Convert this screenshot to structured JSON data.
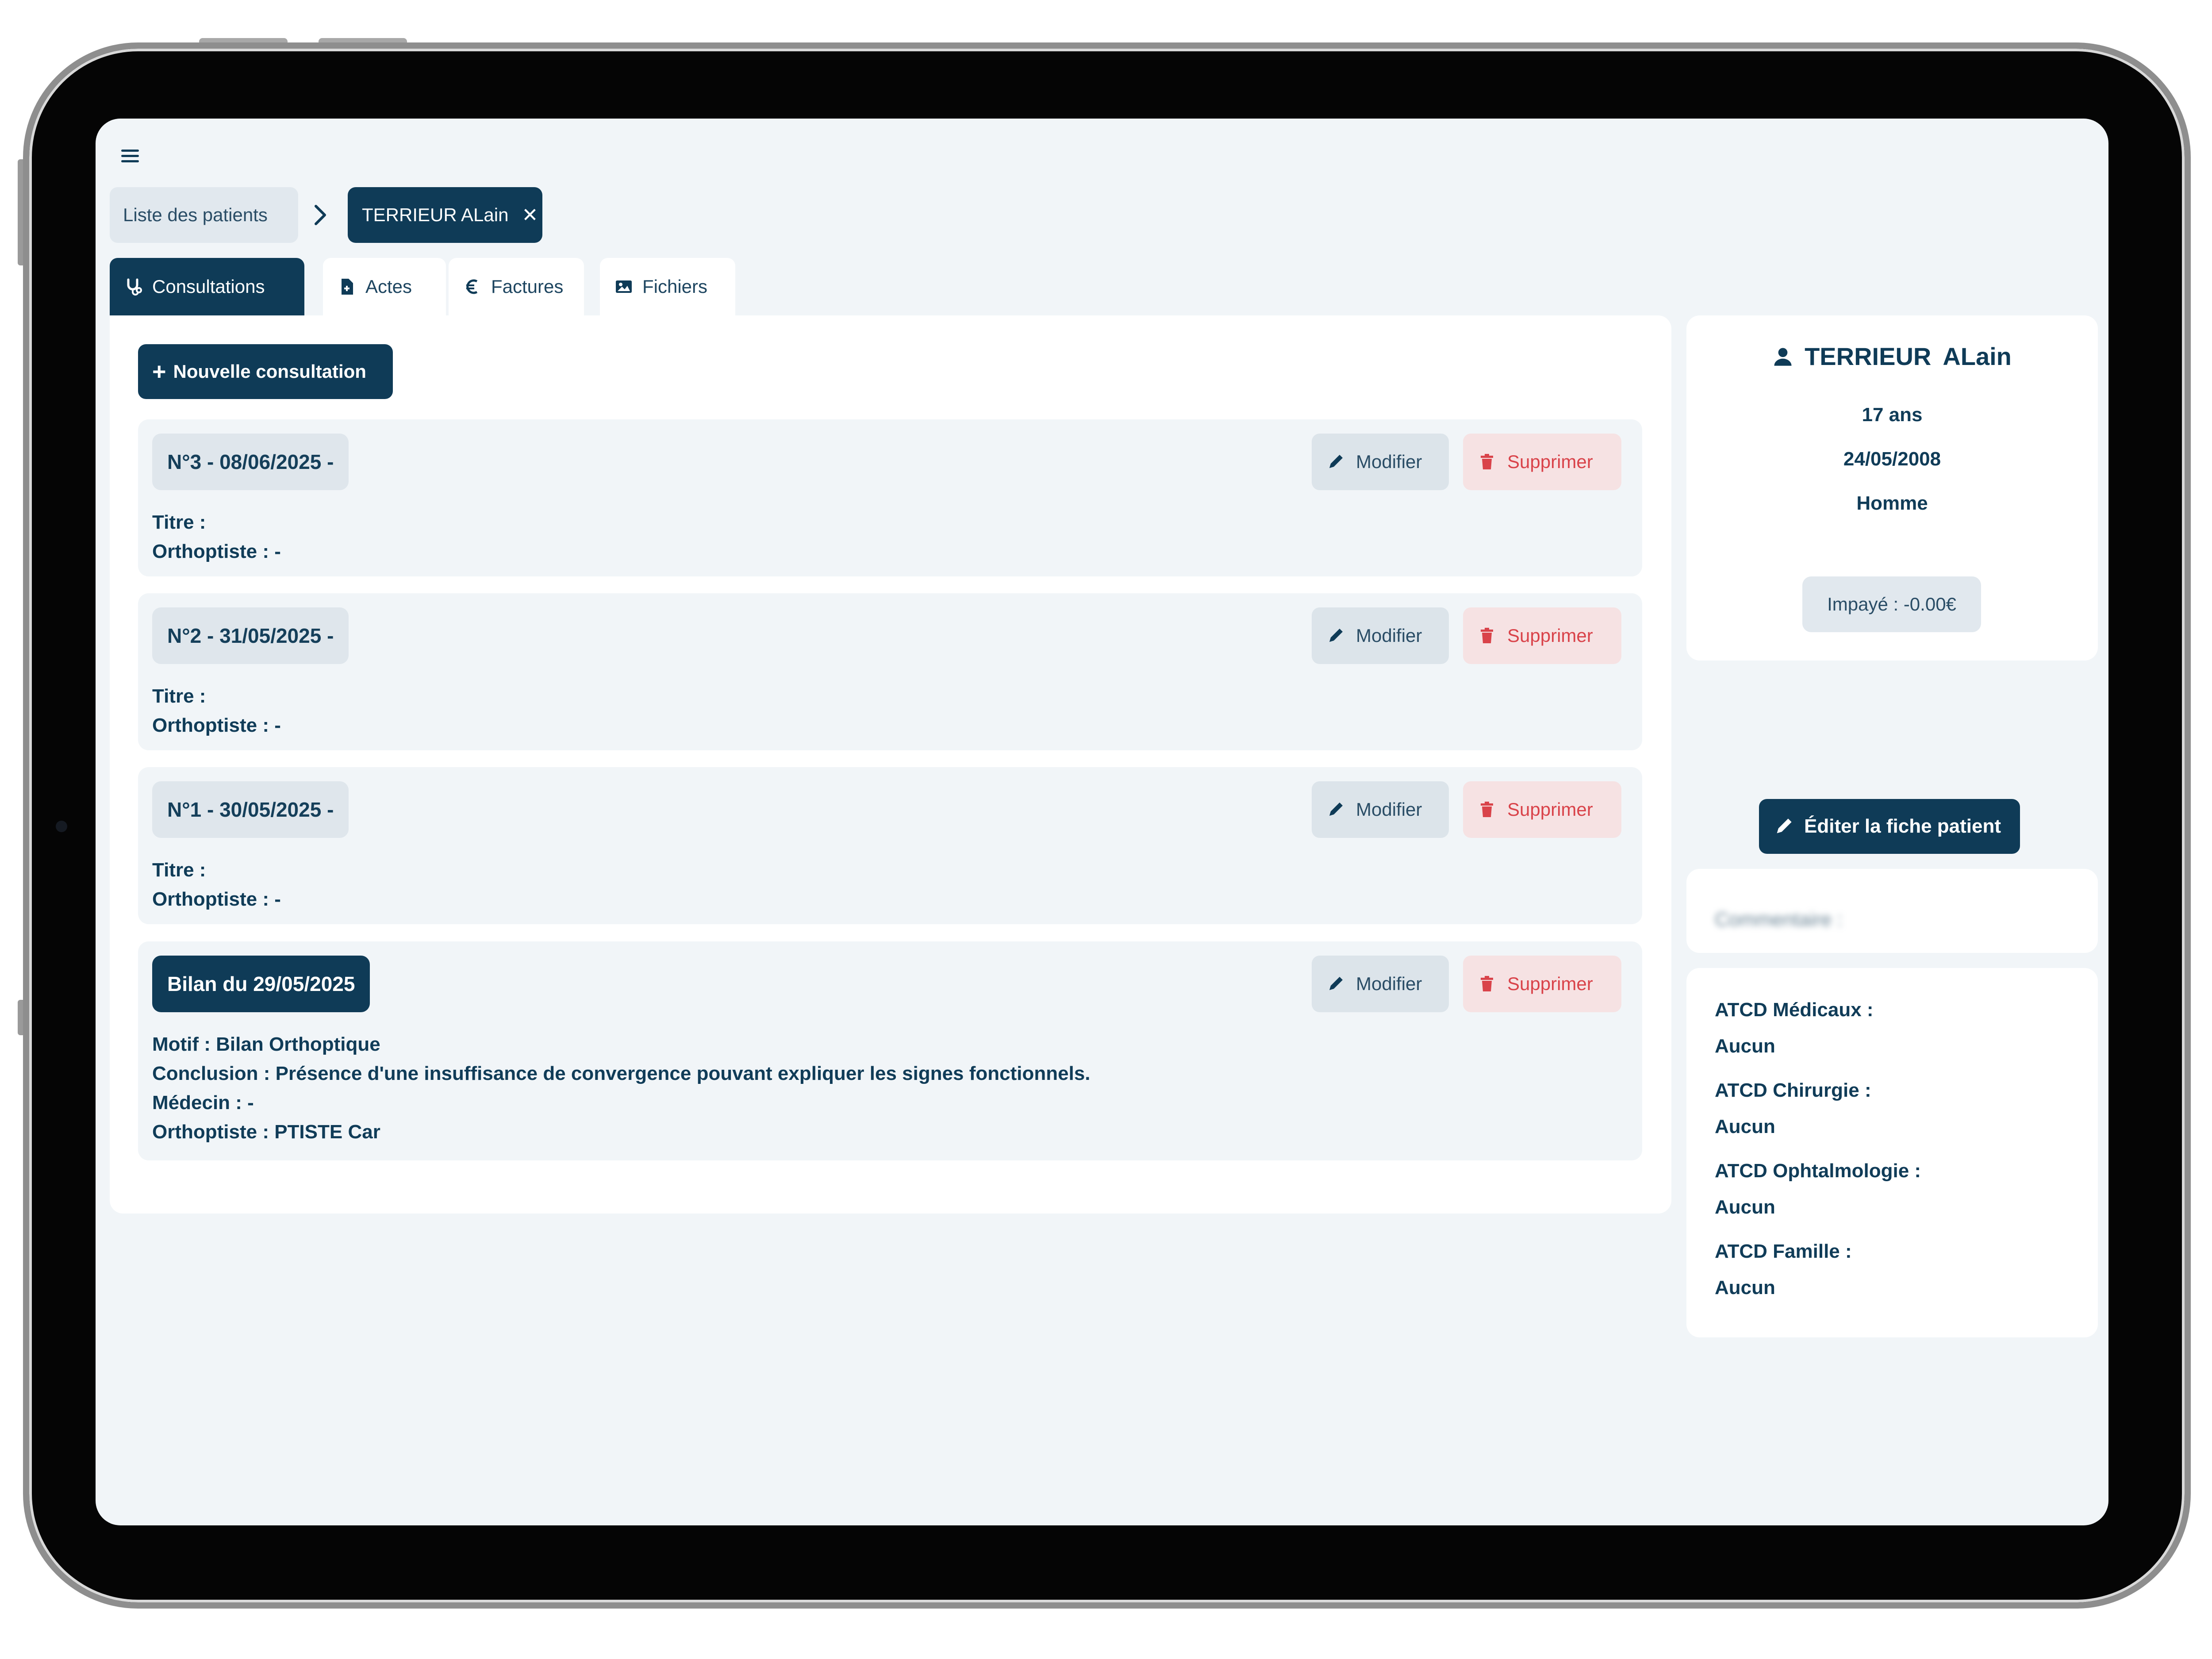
{
  "breadcrumb": {
    "list_label": "Liste des patients",
    "patient_label": "TERRIEUR ALain",
    "close_glyph": "✕"
  },
  "tabs": [
    {
      "label": "Consultations",
      "icon": "stethoscope-icon",
      "active": true
    },
    {
      "label": "Actes",
      "icon": "file-icon",
      "active": false
    },
    {
      "label": "Factures",
      "icon": "euro-icon",
      "active": false
    },
    {
      "label": "Fichiers",
      "icon": "image-icon",
      "active": false
    }
  ],
  "actions": {
    "new_consultation": "Nouvelle consultation",
    "modify": "Modifier",
    "delete": "Supprimer",
    "edit_patient": "Éditer la fiche patient"
  },
  "consultations": [
    {
      "label": "N°3 - 08/06/2025 -",
      "lines": [
        "Titre :",
        "Orthoptiste : -"
      ]
    },
    {
      "label": "N°2 - 31/05/2025 -",
      "lines": [
        "Titre :",
        "Orthoptiste : -"
      ]
    },
    {
      "label": "N°1 - 30/05/2025 -",
      "lines": [
        "Titre :",
        "Orthoptiste : -"
      ]
    },
    {
      "label": "Bilan du 29/05/2025",
      "lines": [
        "Motif : Bilan Orthoptique",
        "Conclusion : Présence d'une insuffisance de convergence pouvant expliquer les signes fonctionnels.",
        "Médecin : -",
        "Orthoptiste : PTISTE Car"
      ]
    }
  ],
  "patient": {
    "last_name": "TERRIEUR",
    "first_name": "ALain",
    "age": "17 ans",
    "birth_date": "24/05/2008",
    "sex": "Homme",
    "unpaid": "Impayé : -0.00€"
  },
  "comment_label": "Commentaire :",
  "atcd": [
    {
      "label": "ATCD Médicaux :",
      "value": "Aucun"
    },
    {
      "label": "ATCD Chirurgie :",
      "value": "Aucun"
    },
    {
      "label": "ATCD Ophtalmologie :",
      "value": "Aucun"
    },
    {
      "label": "ATCD Famille :",
      "value": "Aucun"
    }
  ],
  "colors": {
    "primary": "#0f3b57",
    "danger": "#d9434a",
    "background": "#f1f5f8"
  }
}
